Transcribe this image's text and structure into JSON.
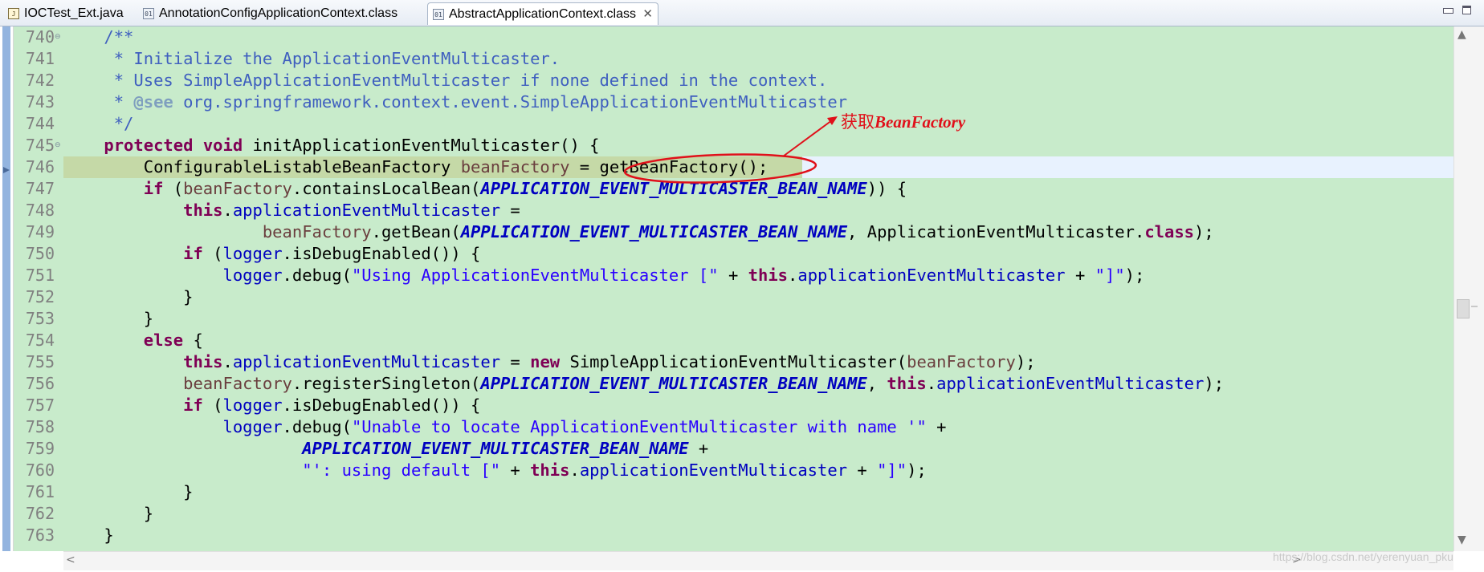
{
  "tabs": [
    {
      "label": "IOCTest_Ext.java",
      "icon": "java-file-icon",
      "icon_text": "J",
      "active": false
    },
    {
      "label": "AnnotationConfigApplicationContext.class",
      "icon": "class-file-icon",
      "icon_text": "01",
      "active": false
    },
    {
      "label": "AbstractApplicationContext.class",
      "icon": "class-file-icon",
      "icon_text": "01",
      "active": true
    }
  ],
  "tab_close_symbol": "✕",
  "code": {
    "background_color": "#c8ebcb",
    "current_line_color": "#e8f2fe",
    "lines": [
      {
        "n": "740",
        "tokens": [
          [
            "",
            "    "
          ],
          [
            "cm",
            "/**"
          ]
        ]
      },
      {
        "n": "741",
        "tokens": [
          [
            "cm",
            "     * Initialize the ApplicationEventMulticaster."
          ]
        ]
      },
      {
        "n": "742",
        "tokens": [
          [
            "cm",
            "     * Uses SimpleApplicationEventMulticaster if none defined in the context."
          ]
        ]
      },
      {
        "n": "743",
        "tokens": [
          [
            "cm",
            "     * "
          ],
          [
            "ann",
            "@see"
          ],
          [
            "cm",
            " org.springframework.context.event.SimpleApplicationEventMulticaster"
          ]
        ]
      },
      {
        "n": "744",
        "tokens": [
          [
            "cm",
            "     */"
          ]
        ]
      },
      {
        "n": "745",
        "tokens": [
          [
            "",
            "    "
          ],
          [
            "kw",
            "protected"
          ],
          [
            "",
            " "
          ],
          [
            "kw",
            "void"
          ],
          [
            "",
            " initApplicationEventMulticaster() {"
          ]
        ]
      },
      {
        "n": "746",
        "tokens": [
          [
            "",
            "        ConfigurableListableBeanFactory "
          ],
          [
            "lv",
            "beanFactory"
          ],
          [
            "",
            " = getBeanFactory();"
          ]
        ]
      },
      {
        "n": "747",
        "tokens": [
          [
            "",
            "        "
          ],
          [
            "kw",
            "if"
          ],
          [
            "",
            " ("
          ],
          [
            "lv",
            "beanFactory"
          ],
          [
            "",
            ".containsLocalBean("
          ],
          [
            "cn",
            "APPLICATION_EVENT_MULTICASTER_BEAN_NAME"
          ],
          [
            "",
            ")) {"
          ]
        ]
      },
      {
        "n": "748",
        "tokens": [
          [
            "",
            "            "
          ],
          [
            "kw",
            "this"
          ],
          [
            "",
            "."
          ],
          [
            "fld",
            "applicationEventMulticaster"
          ],
          [
            "",
            " ="
          ]
        ]
      },
      {
        "n": "749",
        "tokens": [
          [
            "",
            "                    "
          ],
          [
            "lv",
            "beanFactory"
          ],
          [
            "",
            ".getBean("
          ],
          [
            "cn",
            "APPLICATION_EVENT_MULTICASTER_BEAN_NAME"
          ],
          [
            "",
            ", ApplicationEventMulticaster."
          ],
          [
            "kw",
            "class"
          ],
          [
            "",
            ");"
          ]
        ]
      },
      {
        "n": "750",
        "tokens": [
          [
            "",
            "            "
          ],
          [
            "kw",
            "if"
          ],
          [
            "",
            " ("
          ],
          [
            "fld",
            "logger"
          ],
          [
            "",
            ".isDebugEnabled()) {"
          ]
        ]
      },
      {
        "n": "751",
        "tokens": [
          [
            "",
            "                "
          ],
          [
            "fld",
            "logger"
          ],
          [
            "",
            ".debug("
          ],
          [
            "str",
            "\"Using ApplicationEventMulticaster [\""
          ],
          [
            "",
            " + "
          ],
          [
            "kw",
            "this"
          ],
          [
            "",
            "."
          ],
          [
            "fld",
            "applicationEventMulticaster"
          ],
          [
            "",
            " + "
          ],
          [
            "str",
            "\"]\""
          ],
          [
            "",
            ");"
          ]
        ]
      },
      {
        "n": "752",
        "tokens": [
          [
            "",
            "            }"
          ]
        ]
      },
      {
        "n": "753",
        "tokens": [
          [
            "",
            "        }"
          ]
        ]
      },
      {
        "n": "754",
        "tokens": [
          [
            "",
            "        "
          ],
          [
            "kw",
            "else"
          ],
          [
            "",
            " {"
          ]
        ]
      },
      {
        "n": "755",
        "tokens": [
          [
            "",
            "            "
          ],
          [
            "kw",
            "this"
          ],
          [
            "",
            "."
          ],
          [
            "fld",
            "applicationEventMulticaster"
          ],
          [
            "",
            " = "
          ],
          [
            "kw",
            "new"
          ],
          [
            "",
            " SimpleApplicationEventMulticaster("
          ],
          [
            "lv",
            "beanFactory"
          ],
          [
            "",
            ");"
          ]
        ]
      },
      {
        "n": "756",
        "tokens": [
          [
            "",
            "            "
          ],
          [
            "lv",
            "beanFactory"
          ],
          [
            "",
            ".registerSingleton("
          ],
          [
            "cn",
            "APPLICATION_EVENT_MULTICASTER_BEAN_NAME"
          ],
          [
            "",
            ", "
          ],
          [
            "kw",
            "this"
          ],
          [
            "",
            "."
          ],
          [
            "fld",
            "applicationEventMulticaster"
          ],
          [
            "",
            ");"
          ]
        ]
      },
      {
        "n": "757",
        "tokens": [
          [
            "",
            "            "
          ],
          [
            "kw",
            "if"
          ],
          [
            "",
            " ("
          ],
          [
            "fld",
            "logger"
          ],
          [
            "",
            ".isDebugEnabled()) {"
          ]
        ]
      },
      {
        "n": "758",
        "tokens": [
          [
            "",
            "                "
          ],
          [
            "fld",
            "logger"
          ],
          [
            "",
            ".debug("
          ],
          [
            "str",
            "\"Unable to locate ApplicationEventMulticaster with name '\""
          ],
          [
            "",
            " +"
          ]
        ]
      },
      {
        "n": "759",
        "tokens": [
          [
            "",
            "                        "
          ],
          [
            "cn",
            "APPLICATION_EVENT_MULTICASTER_BEAN_NAME"
          ],
          [
            "",
            " +"
          ]
        ]
      },
      {
        "n": "760",
        "tokens": [
          [
            "",
            "                        "
          ],
          [
            "str",
            "\"': using default [\""
          ],
          [
            "",
            " + "
          ],
          [
            "kw",
            "this"
          ],
          [
            "",
            "."
          ],
          [
            "fld",
            "applicationEventMulticaster"
          ],
          [
            "",
            " + "
          ],
          [
            "str",
            "\"]\""
          ],
          [
            "",
            ");"
          ]
        ]
      },
      {
        "n": "761",
        "tokens": [
          [
            "",
            "            }"
          ]
        ]
      },
      {
        "n": "762",
        "tokens": [
          [
            "",
            "        }"
          ]
        ]
      },
      {
        "n": "763",
        "tokens": [
          [
            "",
            "    }"
          ]
        ]
      }
    ]
  },
  "annotation": {
    "label_cn": "获取",
    "label_en": "BeanFactory",
    "color": "#e0101a"
  },
  "scrollbar": {
    "up_arrow": "▲",
    "down_arrow": "▼",
    "left_arrow": "<",
    "right_arrow": ">"
  },
  "watermark": "https://blog.csdn.net/yerenyuan_pku"
}
